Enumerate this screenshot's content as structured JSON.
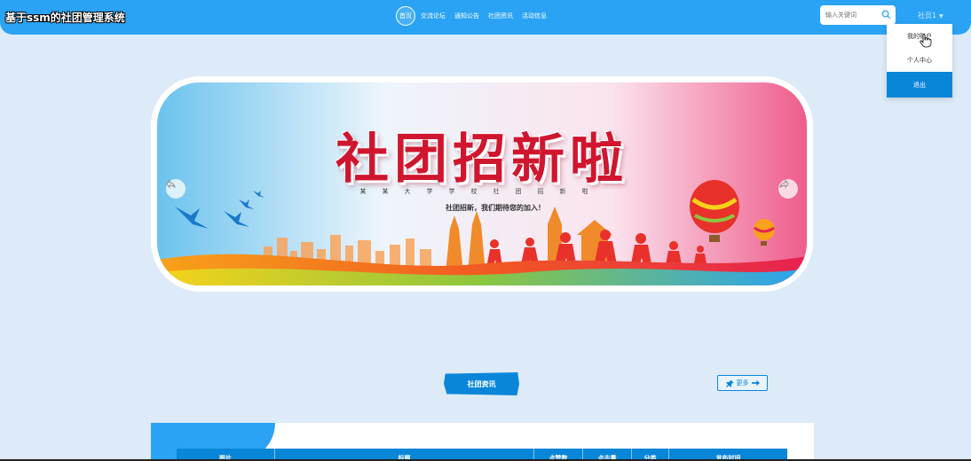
{
  "header": {
    "site_title": "基于ssm的社团管理系统",
    "nav": [
      "首页",
      "交流论坛",
      "通知公告",
      "社团资讯",
      "活动信息"
    ],
    "search_placeholder": "输入关键词",
    "user_label": "社员1"
  },
  "dropdown": {
    "items": [
      "我的账户",
      "个人中心",
      "退出"
    ]
  },
  "banner": {
    "title": "社团招新啦",
    "subtitle": "某某大学学校社团招新啦",
    "slogan": "社团招新，我们期待您的加入！"
  },
  "section": {
    "title": "社团资讯",
    "more_label": "更多"
  },
  "table": {
    "columns": [
      "图片",
      "标题",
      "点赞数",
      "点击量",
      "分类",
      "发布时间"
    ]
  },
  "colors": {
    "header_bg": "#2aa3f4",
    "accent": "#0a86d9",
    "page_bg": "#dcebf7",
    "banner_red": "#d0162f"
  }
}
